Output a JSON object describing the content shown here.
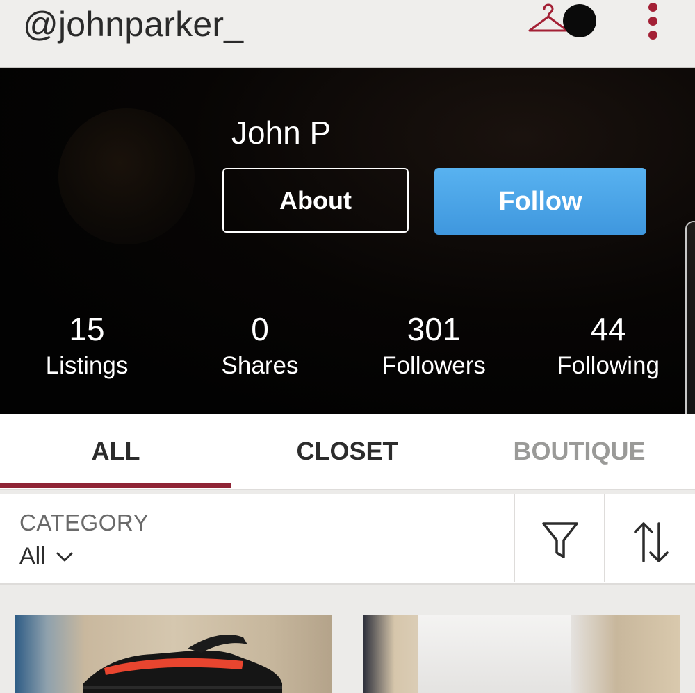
{
  "header": {
    "username": "@johnparker_",
    "icons": {
      "closet": "hanger-icon",
      "notifications": "notification-dot-icon",
      "menu": "more-vert-icon"
    },
    "accent_color": "#a32035"
  },
  "profile": {
    "name": "John P",
    "about_label": "About",
    "follow_label": "Follow",
    "follow_color": "#4ea6e8",
    "stats": [
      {
        "value": "15",
        "label": "Listings"
      },
      {
        "value": "0",
        "label": "Shares"
      },
      {
        "value": "301",
        "label": "Followers"
      },
      {
        "value": "44",
        "label": "Following"
      }
    ]
  },
  "tabs": {
    "items": [
      "ALL",
      "CLOSET",
      "BOUTIQUE"
    ],
    "active": "ALL",
    "indicator_color": "#8f2435"
  },
  "filters": {
    "category_label": "CATEGORY",
    "category_value": "All",
    "icons": {
      "filter": "filter-funnel-icon",
      "sort": "sort-arrows-icon"
    }
  },
  "listings": [
    {
      "image": "sneaker-photo",
      "alt": "black and red sneaker"
    },
    {
      "image": "item-photo",
      "alt": "listing photo"
    }
  ]
}
